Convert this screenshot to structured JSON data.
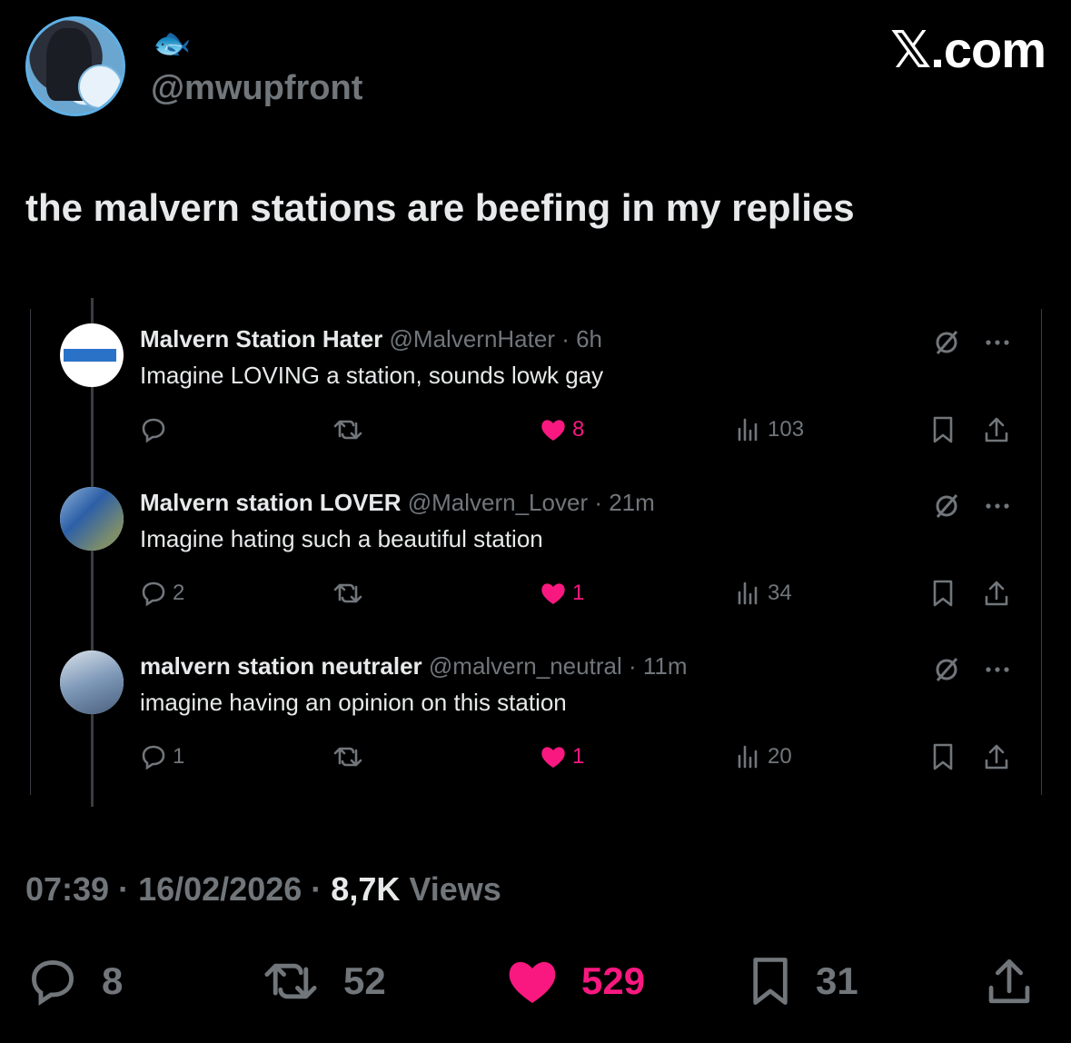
{
  "author": {
    "display_emoji": "🐟",
    "handle": "@mwupfront"
  },
  "brand": "𝕏.com",
  "tweet": {
    "text": "the malvern stations are beefing in my replies"
  },
  "replies": [
    {
      "name": "Malvern Station Hater",
      "handle": "@MalvernHater",
      "time": "· 6h",
      "text": "Imagine LOVING a station, sounds lowk gay",
      "reply_count": "",
      "like_count": "8",
      "views": "103"
    },
    {
      "name": "Malvern station LOVER",
      "handle": "@Malvern_Lover",
      "time": "· 21m",
      "text": "Imagine hating such a beautiful station",
      "reply_count": "2",
      "like_count": "1",
      "views": "34"
    },
    {
      "name": "malvern station neutraler",
      "handle": "@malvern_neutral",
      "time": "· 11m",
      "text": "imagine having an opinion on this station",
      "reply_count": "1",
      "like_count": "1",
      "views": "20"
    }
  ],
  "footer": {
    "time": "07:39",
    "date": "16/02/2026",
    "views_count": "8,7K",
    "views_label": "Views"
  },
  "stats": {
    "replies": "8",
    "reposts": "52",
    "likes": "529",
    "bookmarks": "31"
  },
  "colors": {
    "like": "#f91880",
    "muted": "#71767b",
    "text": "#e7e9ea",
    "background": "#000000"
  }
}
